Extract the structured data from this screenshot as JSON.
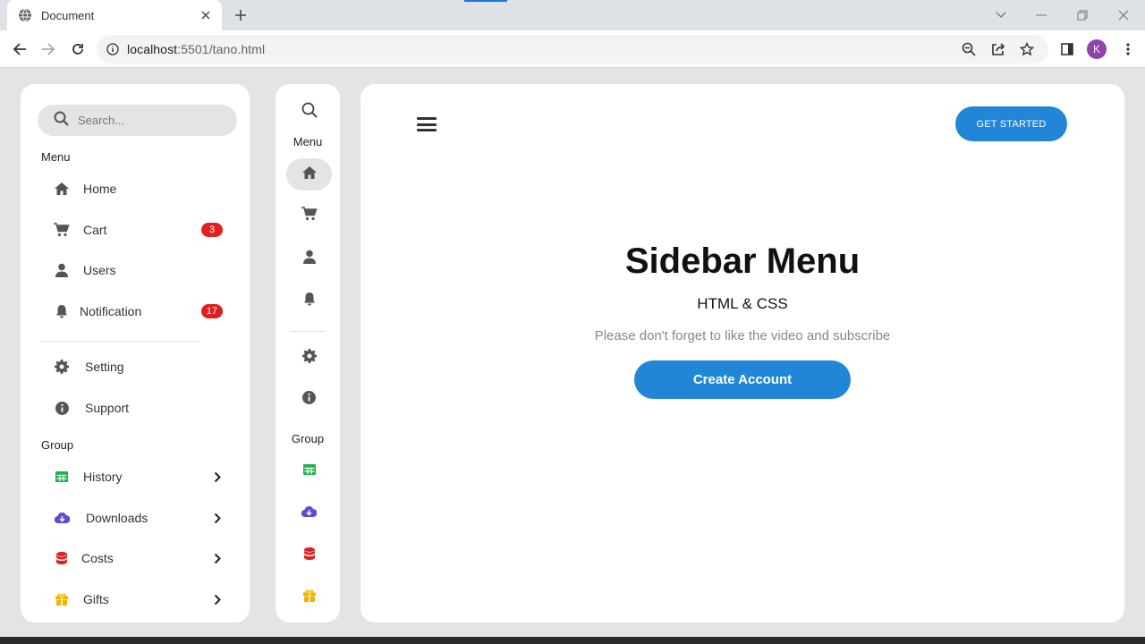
{
  "browser": {
    "tab_title": "Document",
    "url_host": "localhost",
    "url_path": ":5501/tano.html",
    "profile_initial": "K",
    "accent": "#1a73e8"
  },
  "sidebar": {
    "search_placeholder": "Search...",
    "menu_title": "Menu",
    "menu_items": [
      {
        "label": "Home",
        "icon": "home-icon"
      },
      {
        "label": "Cart",
        "icon": "cart-icon",
        "badge": "3"
      },
      {
        "label": "Users",
        "icon": "user-icon"
      },
      {
        "label": "Notification",
        "icon": "bell-icon",
        "badge": "17"
      }
    ],
    "settings_items": [
      {
        "label": "Setting",
        "icon": "gear-icon"
      },
      {
        "label": "Support",
        "icon": "info-icon"
      }
    ],
    "group_title": "Group",
    "group_items": [
      {
        "label": "History",
        "icon": "table-icon",
        "color": "#22b14c"
      },
      {
        "label": "Downloads",
        "icon": "cloud-download-icon",
        "color": "#5b4fd0"
      },
      {
        "label": "Costs",
        "icon": "database-icon",
        "color": "#e02020"
      },
      {
        "label": "Gifts",
        "icon": "gift-icon",
        "color": "#f0b400"
      }
    ],
    "badge_color": "#e02020"
  },
  "minibar": {
    "menu_title": "Menu",
    "group_title": "Group"
  },
  "main": {
    "cta_label": "GET STARTED",
    "title": "Sidebar Menu",
    "subtitle": "HTML & CSS",
    "text": "Please don't forget to like the video and subscribe",
    "button_label": "Create Account",
    "accent": "#2286d8"
  }
}
